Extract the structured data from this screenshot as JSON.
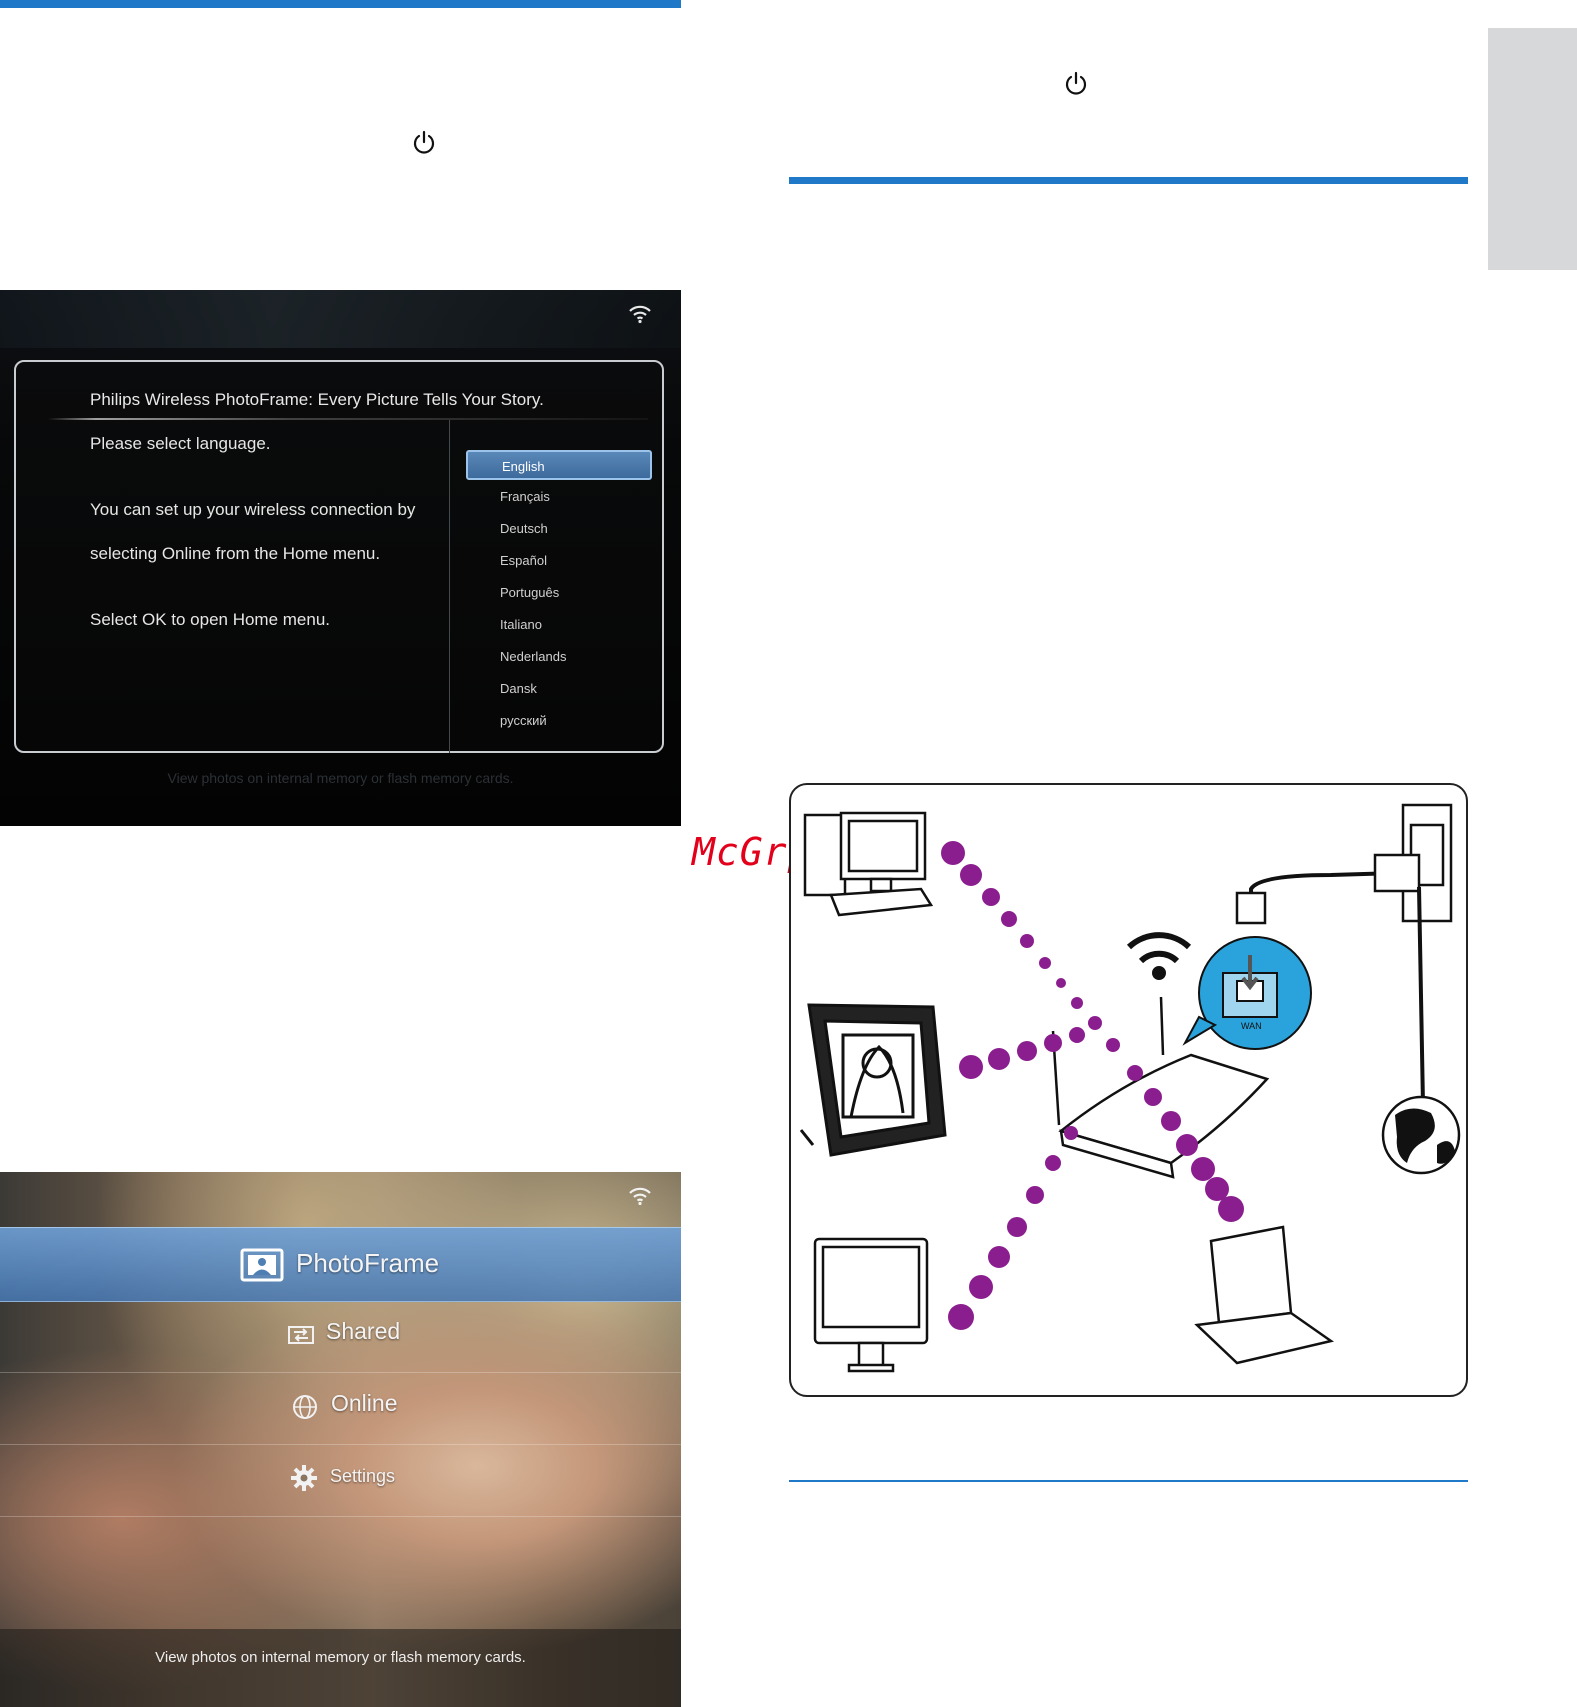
{
  "screen_language": {
    "title": "Philips Wireless PhotoFrame: Every Picture Tells Your Story.",
    "prompt": "Please select language.",
    "info_line1": "You can set up your wireless connection by",
    "info_line2": "selecting Online from the Home menu.",
    "ok_hint": "Select OK to open Home menu.",
    "languages": [
      "English",
      "Français",
      "Deutsch",
      "Español",
      "Português",
      "Italiano",
      "Nederlands",
      "Dansk",
      "русский"
    ],
    "selected_language": "English",
    "footer": "View photos on internal memory or flash memory cards."
  },
  "screen_home": {
    "menu": [
      "PhotoFrame",
      "Shared",
      "Online",
      "Settings"
    ],
    "selected": "PhotoFrame",
    "footer": "View photos on internal memory or flash memory cards."
  },
  "diagram": {
    "router_port_label": "WAN"
  },
  "watermark": "McGrp.Ru",
  "colors": {
    "accent_rule": "#1f78c8",
    "signal_dots": "#8b1e8f",
    "highlight_bubble": "#2aa3dc"
  },
  "icons": [
    "power-icon",
    "wifi-icon",
    "photoframe-icon",
    "shared-icon",
    "globe-icon",
    "gear-icon"
  ]
}
